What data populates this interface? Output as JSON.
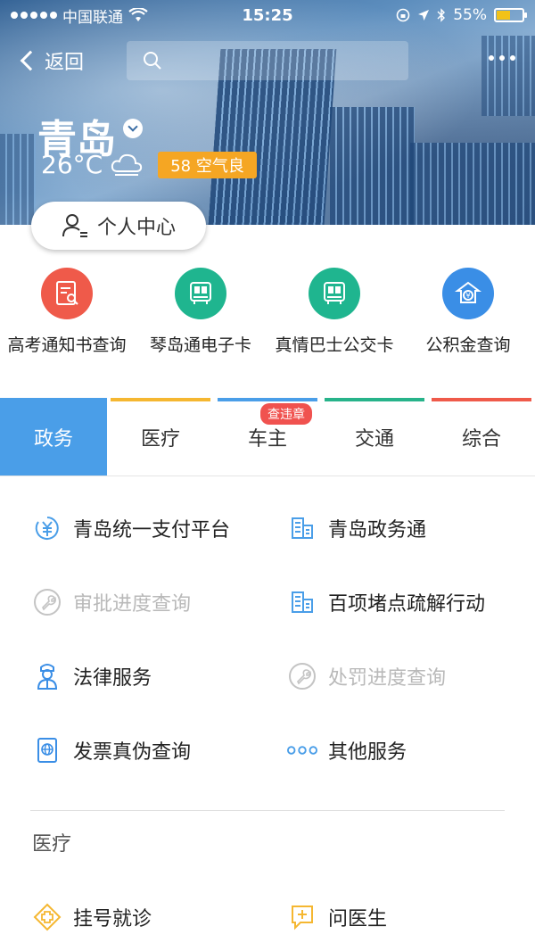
{
  "status_bar": {
    "carrier": "中国联通",
    "time": "15:25",
    "battery": "55%",
    "battery_level": 0.55
  },
  "nav": {
    "back_label": "返回",
    "search_placeholder": ""
  },
  "hero": {
    "city": "青岛",
    "temperature": "26°C",
    "aqi": "58 空气良"
  },
  "personal_center_label": "个人中心",
  "quick_apps": [
    {
      "label": "高考通知书查询",
      "color": "#ef5a4a",
      "icon": "document-search-icon"
    },
    {
      "label": "琴岛通电子卡",
      "color": "#1fb58f",
      "icon": "bus-card-icon"
    },
    {
      "label": "真情巴士公交卡",
      "color": "#1fb58f",
      "icon": "bus-card-icon"
    },
    {
      "label": "公积金查询",
      "color": "#3a8ee6",
      "icon": "fund-icon"
    }
  ],
  "tabs": [
    {
      "label": "政务",
      "color": "#4a9ee8",
      "active": true
    },
    {
      "label": "医疗",
      "color": "#f5b731",
      "active": false
    },
    {
      "label": "车主",
      "color": "#4a9ee8",
      "active": false,
      "badge": "查违章"
    },
    {
      "label": "交通",
      "color": "#27b38a",
      "active": false
    },
    {
      "label": "综合",
      "color": "#ef5a4a",
      "active": false
    }
  ],
  "services": [
    [
      {
        "label": "青岛统一支付平台",
        "icon": "yuan-circle-icon",
        "enabled": true
      },
      {
        "label": "青岛政务通",
        "icon": "building-icon",
        "enabled": true
      }
    ],
    [
      {
        "label": "审批进度查询",
        "icon": "wrench-icon",
        "enabled": false
      },
      {
        "label": "百项堵点疏解行动",
        "icon": "building-icon",
        "enabled": true
      }
    ],
    [
      {
        "label": "法律服务",
        "icon": "lawyer-icon",
        "enabled": true
      },
      {
        "label": "处罚进度查询",
        "icon": "wrench-icon",
        "enabled": false
      }
    ],
    [
      {
        "label": "发票真伪查询",
        "icon": "invoice-globe-icon",
        "enabled": true
      },
      {
        "label": "其他服务",
        "icon": "more-dots-icon",
        "enabled": true
      }
    ]
  ],
  "medical_section": {
    "title": "医疗",
    "items": [
      {
        "label": "挂号就诊",
        "icon": "medical-cross-icon"
      },
      {
        "label": "问医生",
        "icon": "chat-plus-icon"
      }
    ]
  }
}
